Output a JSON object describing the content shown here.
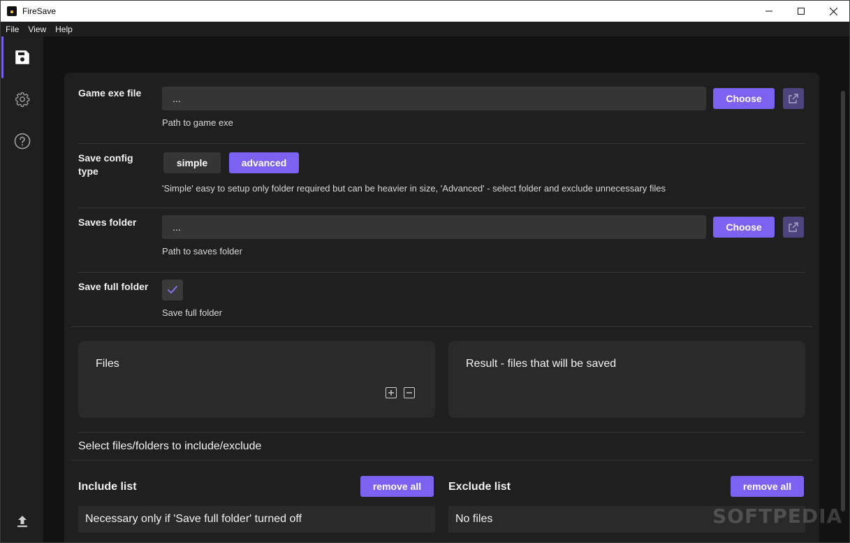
{
  "window": {
    "title": "FireSave"
  },
  "menu": {
    "file": "File",
    "view": "View",
    "help": "Help"
  },
  "game_exe": {
    "label": "Game exe file",
    "value": "...",
    "choose_label": "Choose",
    "hint": "Path to game exe"
  },
  "save_config": {
    "label": "Save config type",
    "option_simple": "simple",
    "option_advanced": "advanced",
    "selected": "advanced",
    "hint": "'Simple' easy to setup only folder required but can be heavier in size, 'Advanced' - select folder and exclude unnecessary files"
  },
  "saves_folder": {
    "label": "Saves folder",
    "value": "...",
    "choose_label": "Choose",
    "hint": "Path to saves folder"
  },
  "save_full_folder": {
    "label": "Save full folder",
    "checked": true,
    "hint": "Save full folder"
  },
  "files_box": {
    "title": "Files"
  },
  "result_box": {
    "title": "Result - files that will be saved"
  },
  "select_hint": "Select files/folders to include/exclude",
  "include_list": {
    "title": "Include list",
    "remove_all_label": "remove all",
    "empty_text": "Necessary only if 'Save full folder' turned off"
  },
  "exclude_list": {
    "title": "Exclude list",
    "remove_all_label": "remove all",
    "empty_text": "No files"
  },
  "watermark": "SOFTPEDIA",
  "colors": {
    "accent": "#7b62f0",
    "accent_dim": "#4d437e",
    "panel": "#1f1f1f",
    "input": "#353535"
  }
}
